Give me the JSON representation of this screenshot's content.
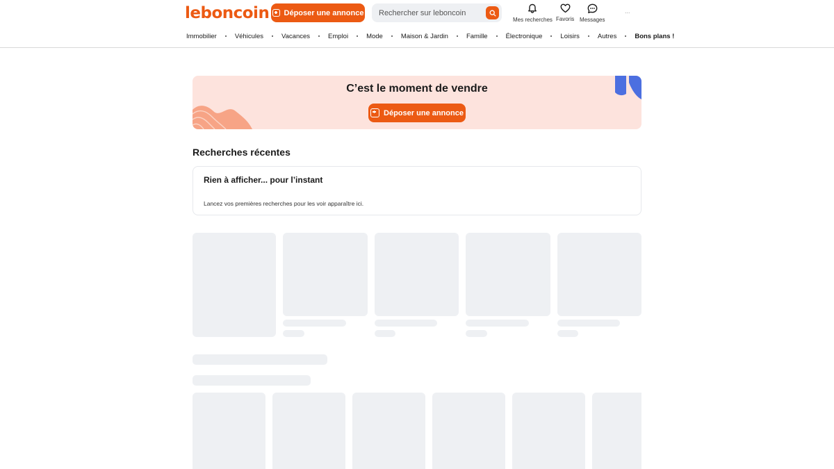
{
  "header": {
    "logo_text": "leboncoin",
    "post_button_label": "Déposer une annonce",
    "search_placeholder": "Rechercher sur leboncoin",
    "nav": [
      {
        "label": "Mes recherches",
        "icon": "bell-icon"
      },
      {
        "label": "Favoris",
        "icon": "heart-icon"
      },
      {
        "label": "Messages",
        "icon": "chat-bubble-icon"
      }
    ],
    "avatar_placeholder": "...",
    "accent_color": "#ec5a13"
  },
  "categories": [
    "Immobilier",
    "Véhicules",
    "Vacances",
    "Emploi",
    "Mode",
    "Maison & Jardin",
    "Famille",
    "Électronique",
    "Loisirs",
    "Autres",
    "Bons plans !"
  ],
  "banner": {
    "title": "C’est le moment de vendre",
    "button_label": "Déposer une annonce",
    "background_color": "#fde3dd"
  },
  "recent": {
    "title": "Recherches récentes",
    "empty_title": "Rien à afficher... pour l’instant",
    "empty_subtitle": "Lancez vos premières recherches pour les voir apparaître ici."
  },
  "loading_placeholder_color": "#eef0f3"
}
